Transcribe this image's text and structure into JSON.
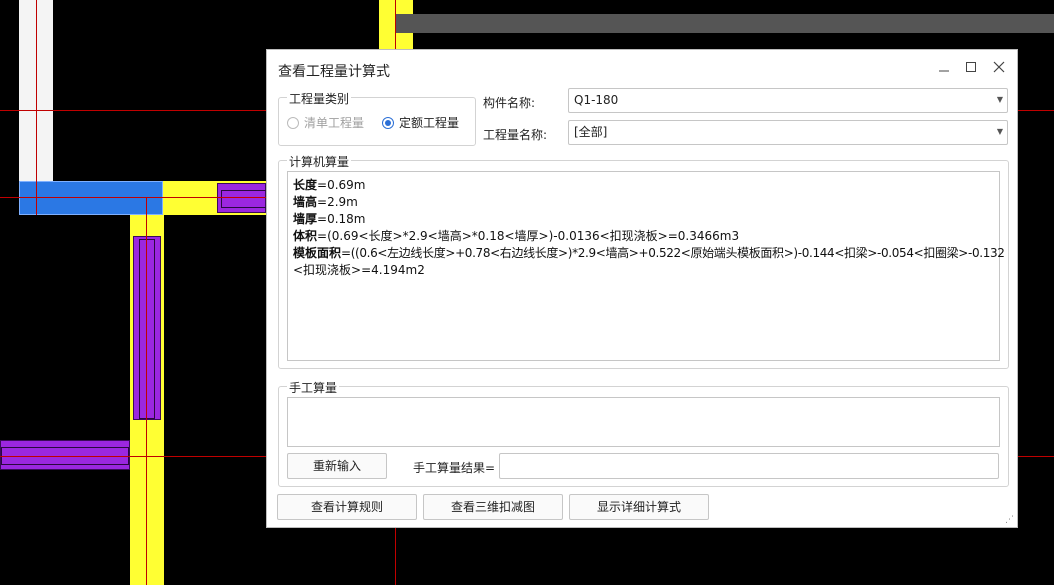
{
  "dialog": {
    "title": "查看工程量计算式",
    "window_controls": {
      "minimize_icon": "minimize-icon",
      "maximize_icon": "maximize-icon",
      "close_icon": "close-icon"
    }
  },
  "quantity_type": {
    "legend": "工程量类别",
    "options": [
      {
        "label": "清单工程量",
        "checked": false,
        "disabled": true
      },
      {
        "label": "定额工程量",
        "checked": true,
        "disabled": false
      }
    ]
  },
  "component": {
    "label": "构件名称:",
    "value": "Q1-180"
  },
  "quantity_name": {
    "label": "工程量名称:",
    "value": "[全部]"
  },
  "computer_calc": {
    "legend": "计算机算量",
    "lines": [
      {
        "key": "长度",
        "expr": "=0.69m"
      },
      {
        "key": "墙高",
        "expr": "=2.9m"
      },
      {
        "key": "墙厚",
        "expr": "=0.18m"
      },
      {
        "key": "体积",
        "expr": "=(0.69<长度>*2.9<墙高>*0.18<墙厚>)-0.0136<扣现浇板>=0.3466m3"
      },
      {
        "key": "模板面积",
        "expr": "=((0.6<左边线长度>+0.78<右边线长度>)*2.9<墙高>+0.522<原始端头模板面积>)-0.144<扣梁>-0.054<扣圈梁>-0.132"
      },
      {
        "key": "",
        "expr": "<扣现浇板>=4.194m2"
      }
    ]
  },
  "manual_calc": {
    "legend": "手工算量",
    "reenter_button": "重新输入",
    "result_label": "手工算量结果=",
    "result_value": ""
  },
  "buttons": {
    "view_rules": "查看计算规则",
    "view_3d": "查看三维扣减图",
    "show_detail": "显示详细计算式"
  },
  "colors": {
    "wall_yellow": "#ffff33",
    "beam_purple": "#9b27e0",
    "selected_blue": "#2b78e4",
    "axis_red": "#c00000",
    "accent": "#2b6fd6"
  }
}
